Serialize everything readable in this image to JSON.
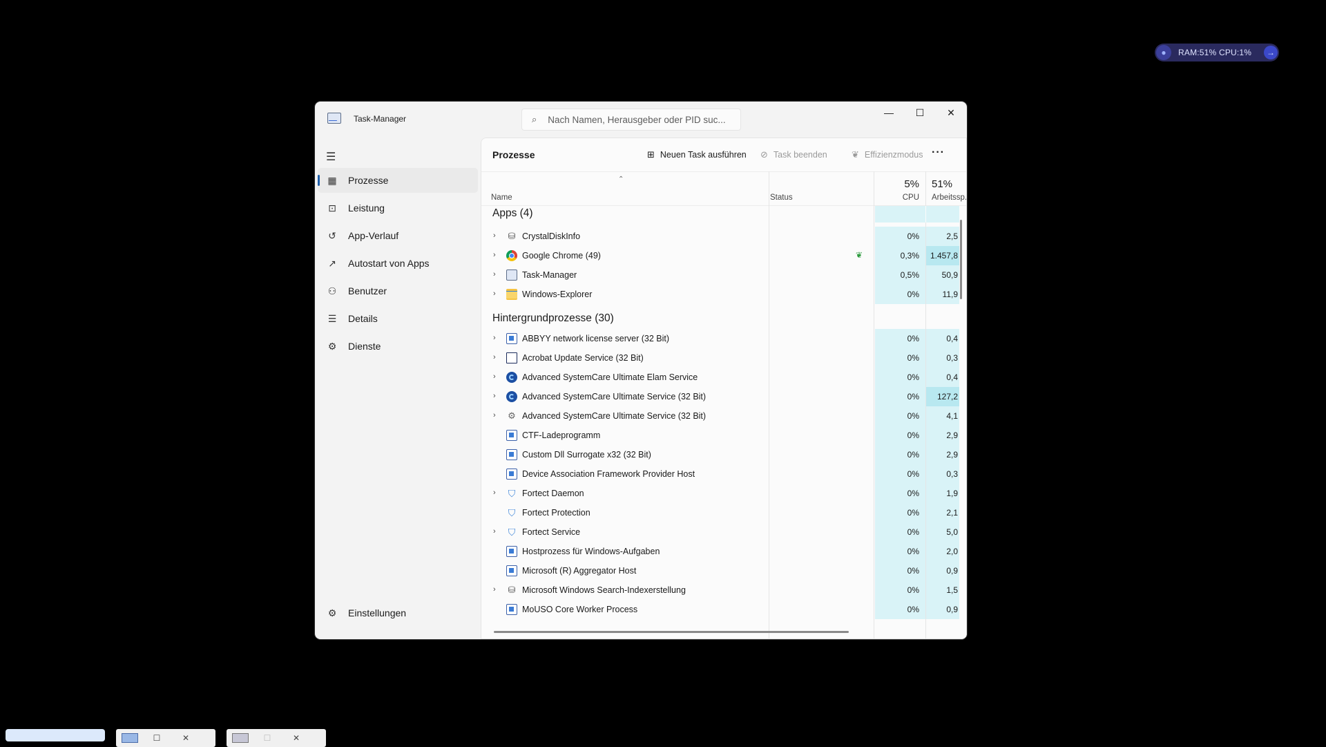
{
  "widget": {
    "text": "RAM:51%  CPU:1%"
  },
  "window": {
    "title": "Task-Manager",
    "search_placeholder": "Nach Namen, Herausgeber oder PID suc...",
    "minimize": "—",
    "maximize": "☐",
    "close": "✕"
  },
  "sidebar": {
    "items": [
      {
        "label": "Prozesse",
        "icon": "processes-icon"
      },
      {
        "label": "Leistung",
        "icon": "performance-icon"
      },
      {
        "label": "App-Verlauf",
        "icon": "history-icon"
      },
      {
        "label": "Autostart von Apps",
        "icon": "startup-icon"
      },
      {
        "label": "Benutzer",
        "icon": "users-icon"
      },
      {
        "label": "Details",
        "icon": "details-icon"
      },
      {
        "label": "Dienste",
        "icon": "services-icon"
      }
    ],
    "settings": "Einstellungen"
  },
  "toolbar": {
    "page_title": "Prozesse",
    "new_task": "Neuen Task ausführen",
    "end_task": "Task beenden",
    "efficiency": "Effizienzmodus",
    "more": "···"
  },
  "columns": {
    "name": "Name",
    "status": "Status",
    "cpu_total": "5%",
    "cpu": "CPU",
    "mem_total": "51%",
    "mem": "Arbeitssp."
  },
  "groups": {
    "apps": "Apps (4)",
    "background": "Hintergrundprozesse (30)"
  },
  "apps": [
    {
      "name": "CrystalDiskInfo",
      "cpu": "0%",
      "mem": "2,5",
      "expand": true
    },
    {
      "name": "Google Chrome (49)",
      "cpu": "0,3%",
      "mem": "1.457,8",
      "expand": true
    },
    {
      "name": "Task-Manager",
      "cpu": "0,5%",
      "mem": "50,9",
      "expand": true
    },
    {
      "name": "Windows-Explorer",
      "cpu": "0%",
      "mem": "11,9",
      "expand": true
    }
  ],
  "background": [
    {
      "name": "ABBYY network license server (32 Bit)",
      "cpu": "0%",
      "mem": "0,4",
      "expand": true
    },
    {
      "name": "Acrobat Update Service (32 Bit)",
      "cpu": "0%",
      "mem": "0,3",
      "expand": true
    },
    {
      "name": "Advanced SystemCare Ultimate Elam Service",
      "cpu": "0%",
      "mem": "0,4",
      "expand": true
    },
    {
      "name": "Advanced SystemCare Ultimate Service (32 Bit)",
      "cpu": "0%",
      "mem": "127,2",
      "expand": true
    },
    {
      "name": "Advanced SystemCare Ultimate Service (32 Bit)",
      "cpu": "0%",
      "mem": "4,1",
      "expand": true
    },
    {
      "name": "CTF-Ladeprogramm",
      "cpu": "0%",
      "mem": "2,9",
      "expand": false
    },
    {
      "name": "Custom Dll Surrogate x32 (32 Bit)",
      "cpu": "0%",
      "mem": "2,9",
      "expand": false
    },
    {
      "name": "Device Association Framework Provider Host",
      "cpu": "0%",
      "mem": "0,3",
      "expand": false
    },
    {
      "name": "Fortect Daemon",
      "cpu": "0%",
      "mem": "1,9",
      "expand": true
    },
    {
      "name": "Fortect Protection",
      "cpu": "0%",
      "mem": "2,1",
      "expand": false
    },
    {
      "name": "Fortect Service",
      "cpu": "0%",
      "mem": "5,0",
      "expand": true
    },
    {
      "name": "Hostprozess für Windows-Aufgaben",
      "cpu": "0%",
      "mem": "2,0",
      "expand": false
    },
    {
      "name": "Microsoft (R) Aggregator Host",
      "cpu": "0%",
      "mem": "0,9",
      "expand": false
    },
    {
      "name": "Microsoft Windows Search-Indexerstellung",
      "cpu": "0%",
      "mem": "1,5",
      "expand": true
    },
    {
      "name": "MoUSO Core Worker Process",
      "cpu": "0%",
      "mem": "0,9",
      "expand": false
    }
  ],
  "colors": {
    "accent": "#1f5faa",
    "heat": "#d9f3f7",
    "heat_high": "#b8e8f0"
  }
}
